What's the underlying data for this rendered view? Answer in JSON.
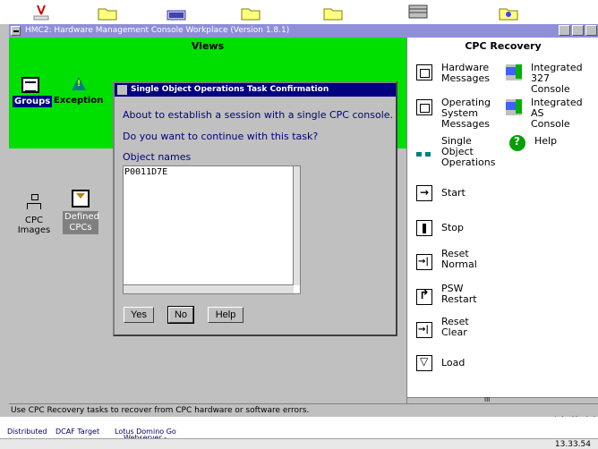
{
  "window": {
    "title": "HMC2: Hardware Management Console Workplace (Version 1.8.1)"
  },
  "views": {
    "title": "Views",
    "groups_label": "Groups",
    "exceptions_label": "Exception",
    "cpc_images_line1": "CPC",
    "cpc_images_line2": "Images",
    "defined_cpcs_line1": "Defined",
    "defined_cpcs_line2": "CPCs"
  },
  "dialog": {
    "title": "Single Object Operations Task Confirmation",
    "message1": "About to establish a session with a single CPC console.",
    "message2": "Do you want to continue with this task?",
    "object_names_label": "Object names",
    "object_names": [
      "P0011D7E"
    ],
    "buttons": {
      "yes": "Yes",
      "no": "No",
      "help": "Help"
    }
  },
  "right_pane": {
    "title": "CPC Recovery",
    "tasks": {
      "hw_messages": [
        "Hardware",
        "Messages"
      ],
      "os_messages": [
        "Operating",
        "System",
        "Messages"
      ],
      "single_object": [
        "Single",
        "Object",
        "Operations"
      ],
      "start": "Start",
      "stop": "Stop",
      "reset_normal": [
        "Reset",
        "Normal"
      ],
      "psw_restart": [
        "PSW",
        "Restart"
      ],
      "reset_clear": [
        "Reset",
        "Clear"
      ],
      "load": "Load",
      "integrated_3270": [
        "Integrated 327",
        "Console"
      ],
      "integrated_ascii": [
        "Integrated AS",
        "Console"
      ],
      "help": "Help"
    },
    "scroll_grip": "III"
  },
  "status": {
    "text": "Use CPC Recovery tasks to recover from CPC hardware or software errors."
  },
  "taskbar": {
    "items": [
      "Distributed",
      "DCAF Target",
      "Lotus Domino Go",
      "Webserver -"
    ],
    "clock": "13.33.54"
  }
}
